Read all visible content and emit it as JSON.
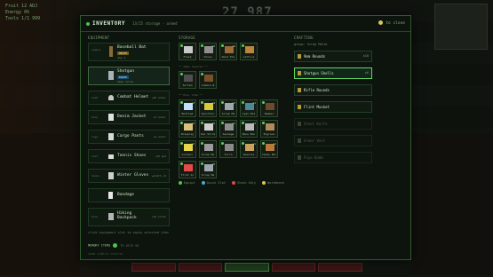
{
  "hud": {
    "score": "27 987",
    "stats": [
      "Fruit 12 ADJ",
      "Energy 0%",
      "Tools 1/1 999"
    ]
  },
  "panel": {
    "title": "INVENTORY",
    "subtitle": "13/25 storage  ·  armed",
    "close_label": "to close"
  },
  "equipment": {
    "header": "EQUIPMENT",
    "slots": [
      {
        "slot": "weapon",
        "name": "Baseball Bat",
        "badge": "MELEE",
        "detail": "dmg 4"
      },
      {
        "slot": "",
        "name": "Shotgun",
        "badge": "EQUIP",
        "detail": "ammo 12/12"
      },
      {
        "slot": "head",
        "name": "Combat Helmet",
        "stat": "+20 armor"
      },
      {
        "slot": "body",
        "name": "Denim Jacket",
        "stat": "+5 armor"
      },
      {
        "slot": "legs",
        "name": "Cargo Pants",
        "stat": "+4 armor"
      },
      {
        "slot": "feet",
        "name": "Tennis Shoes",
        "stat": "+10 spd"
      },
      {
        "slot": "hands",
        "name": "Winter Gloves",
        "stat": "warmth +5"
      },
      {
        "slot": "",
        "name": "Bandage",
        "stat": ""
      },
      {
        "slot": "back",
        "name": "Hiking Backpack",
        "stat": "+10 slots"
      }
    ],
    "hint": "click equipment slot to equip selected item",
    "memory_label": "MEMORY ITEMS",
    "memory_value": "to pick up",
    "footer": "some subtle control"
  },
  "storage": {
    "header": "STORAGE",
    "section_ammo": "── Ammo reserve ──",
    "section_items": "── Misc item ──",
    "row1": [
      {
        "label": "Flask",
        "qty": "",
        "color": "#c9c9c9"
      },
      {
        "label": "Stone",
        "qty": "x2",
        "color": "#8f8f8f"
      },
      {
        "label": "Wood Pla",
        "qty": "x4",
        "color": "#9a6a3a"
      },
      {
        "label": "Lattice",
        "qty": "",
        "color": "#b8863c"
      }
    ],
    "row2": [
      {
        "label": "Sorted",
        "qty": "",
        "color": "#4f4f4f"
      },
      {
        "label": "Common W",
        "qty": "",
        "color": "#7a4f2a"
      }
    ],
    "row3": [
      {
        "label": "Bottled",
        "qty": "x2",
        "color": "#bfe0ff"
      },
      {
        "label": "Splitter",
        "qty": "x4",
        "color": "#d6c93c"
      },
      {
        "label": "Scrap Me",
        "qty": "x3",
        "color": "#9da7b0"
      },
      {
        "label": "Cyan Met",
        "qty": "x1",
        "color": "#4a8a9a"
      },
      {
        "label": "Hammer",
        "qty": "",
        "color": "#6a4c2c"
      }
    ],
    "row4": [
      {
        "label": "Roleplay",
        "qty": "x2",
        "color": "#d8c27a"
      },
      {
        "label": "Pan Stick",
        "qty": "x5",
        "color": "#cfcfcf"
      },
      {
        "label": "Sandage",
        "qty": "x1",
        "color": "#8f8f8f"
      },
      {
        "label": "Bone Bon",
        "qty": "x3",
        "color": "#b9b9b9"
      },
      {
        "label": "Engrave",
        "qty": "",
        "color": "#b08a5a"
      }
    ],
    "row5": [
      {
        "label": "Lockpin",
        "qty": "x2",
        "color": "#e6d44a"
      },
      {
        "label": "Scrap Me",
        "qty": "",
        "color": "#9a9a9a"
      },
      {
        "label": "Torch",
        "qty": "",
        "color": "#8a8a8a"
      },
      {
        "label": "Spatula",
        "qty": "x1",
        "color": "#c9a15a"
      },
      {
        "label": "Candy Bar",
        "qty": "x1",
        "color": "#b87a3a"
      }
    ],
    "row6": [
      {
        "label": "First Ai",
        "qty": "",
        "color": "#e34a4a"
      },
      {
        "label": "Scrap Me",
        "qty": "x5",
        "color": "#9da7b0"
      }
    ],
    "legend": [
      "Equipt",
      "Quick Slot",
      "Stash Only",
      "Workbench"
    ]
  },
  "crafting": {
    "header": "CRAFTING",
    "group": "Scrap Metal",
    "recipes": [
      {
        "name": "9mm Rounds",
        "qty": "x10",
        "state": "normal"
      },
      {
        "name": "Shotgun Shells",
        "qty": "x6",
        "state": "selected"
      },
      {
        "name": "Rifle Rounds",
        "qty": "",
        "state": "normal"
      },
      {
        "name": "Flint Musket",
        "qty": "",
        "state": "normal"
      },
      {
        "name": "Steel Knife",
        "qty": "",
        "state": "dim"
      },
      {
        "name": "Armor Vest",
        "qty": "",
        "state": "dim"
      },
      {
        "name": "Pipe Bomb",
        "qty": "",
        "state": "dim"
      }
    ]
  },
  "colors": {
    "accent": "#5fd45f",
    "panel_border": "#2e5a2c"
  }
}
